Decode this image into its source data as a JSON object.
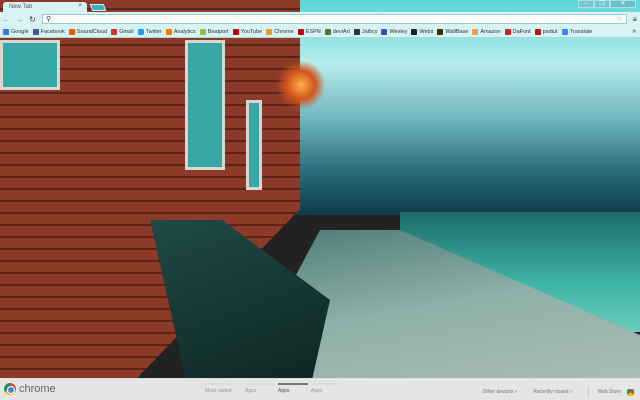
{
  "tab": {
    "title": "New Tab",
    "close": "×"
  },
  "window_controls": {
    "minimize": "–",
    "restore": "❐",
    "close": "✕"
  },
  "toolbar": {
    "back": "←",
    "forward": "→",
    "reload": "↻",
    "omnibox_value": "",
    "star": "☆",
    "menu": "≡"
  },
  "bookmarks": [
    {
      "label": "Google",
      "color": "#3b78e7"
    },
    {
      "label": "Facebook",
      "color": "#3b5998"
    },
    {
      "label": "SoundCloud",
      "color": "#ff5500"
    },
    {
      "label": "Gmail",
      "color": "#d93025"
    },
    {
      "label": "Twitter",
      "color": "#1da1f2"
    },
    {
      "label": "Analytics",
      "color": "#f57c00"
    },
    {
      "label": "Beatport",
      "color": "#8bc34a"
    },
    {
      "label": "YouTube",
      "color": "#cc0000"
    },
    {
      "label": "Chrome",
      "color": "#e0a030"
    },
    {
      "label": "ESPN",
      "color": "#cc0000"
    },
    {
      "label": "deviArt",
      "color": "#4a7a30"
    },
    {
      "label": "Jalbcy",
      "color": "#333333"
    },
    {
      "label": "Wesley",
      "color": "#3355aa"
    },
    {
      "label": "Webs",
      "color": "#222222"
    },
    {
      "label": "WallBase",
      "color": "#333300"
    },
    {
      "label": "Amazon",
      "color": "#e0a060"
    },
    {
      "label": "DaFont",
      "color": "#cc2222"
    },
    {
      "label": "psdtut",
      "color": "#bb1111"
    },
    {
      "label": "Translate",
      "color": "#4285f4"
    }
  ],
  "bookmarks_more": "»",
  "bottom": {
    "logo_text": "chrome",
    "pages": [
      {
        "label": "Most visited",
        "active": false
      },
      {
        "label": "Apps",
        "active": false
      },
      {
        "label": "Apps",
        "active": true
      },
      {
        "label": "Apps",
        "active": false
      }
    ],
    "other_devices": "Other devices ▿",
    "recently_closed": "Recently closed ▿",
    "web_store": "Web Store"
  }
}
